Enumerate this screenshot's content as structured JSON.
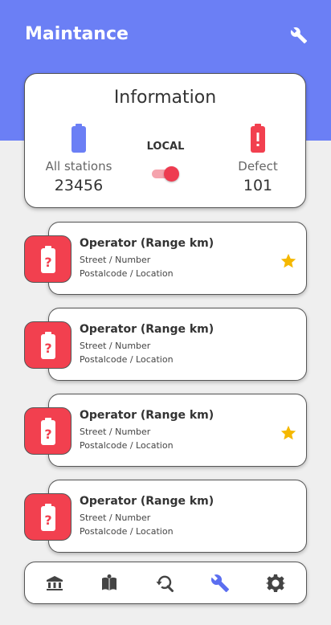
{
  "header": {
    "title": "Maintance",
    "action_icon": "wrench-icon"
  },
  "info": {
    "title": "Information",
    "all_stations": {
      "label": "All stations",
      "value": "23456",
      "icon": "battery-icon",
      "color": "#6b7ff5"
    },
    "mode": {
      "label": "LOCAL",
      "toggle_on": true
    },
    "defect": {
      "label": "Defect",
      "value": "101",
      "icon": "battery-alert-icon",
      "color": "#f2404f"
    }
  },
  "stations": [
    {
      "title": "Operator (Range km)",
      "street": "Street / Number",
      "location": "Postalcode / Location",
      "favorite": true
    },
    {
      "title": "Operator (Range km)",
      "street": "Street / Number",
      "location": "Postalcode / Location",
      "favorite": false
    },
    {
      "title": "Operator (Range km)",
      "street": "Street / Number",
      "location": "Postalcode / Location",
      "favorite": true
    },
    {
      "title": "Operator (Range km)",
      "street": "Street / Number",
      "location": "Postalcode / Location",
      "favorite": false
    }
  ],
  "nav": {
    "items": [
      {
        "icon": "bank-icon",
        "active": false
      },
      {
        "icon": "book-icon",
        "active": false
      },
      {
        "icon": "search-history-icon",
        "active": false
      },
      {
        "icon": "wrench-icon",
        "active": true
      },
      {
        "icon": "gear-icon",
        "active": false
      }
    ],
    "active_color": "#5b6ef0",
    "inactive_color": "#444444"
  },
  "colors": {
    "accent": "#6b7ff5",
    "alert": "#f2404f",
    "star": "#f5b800"
  }
}
